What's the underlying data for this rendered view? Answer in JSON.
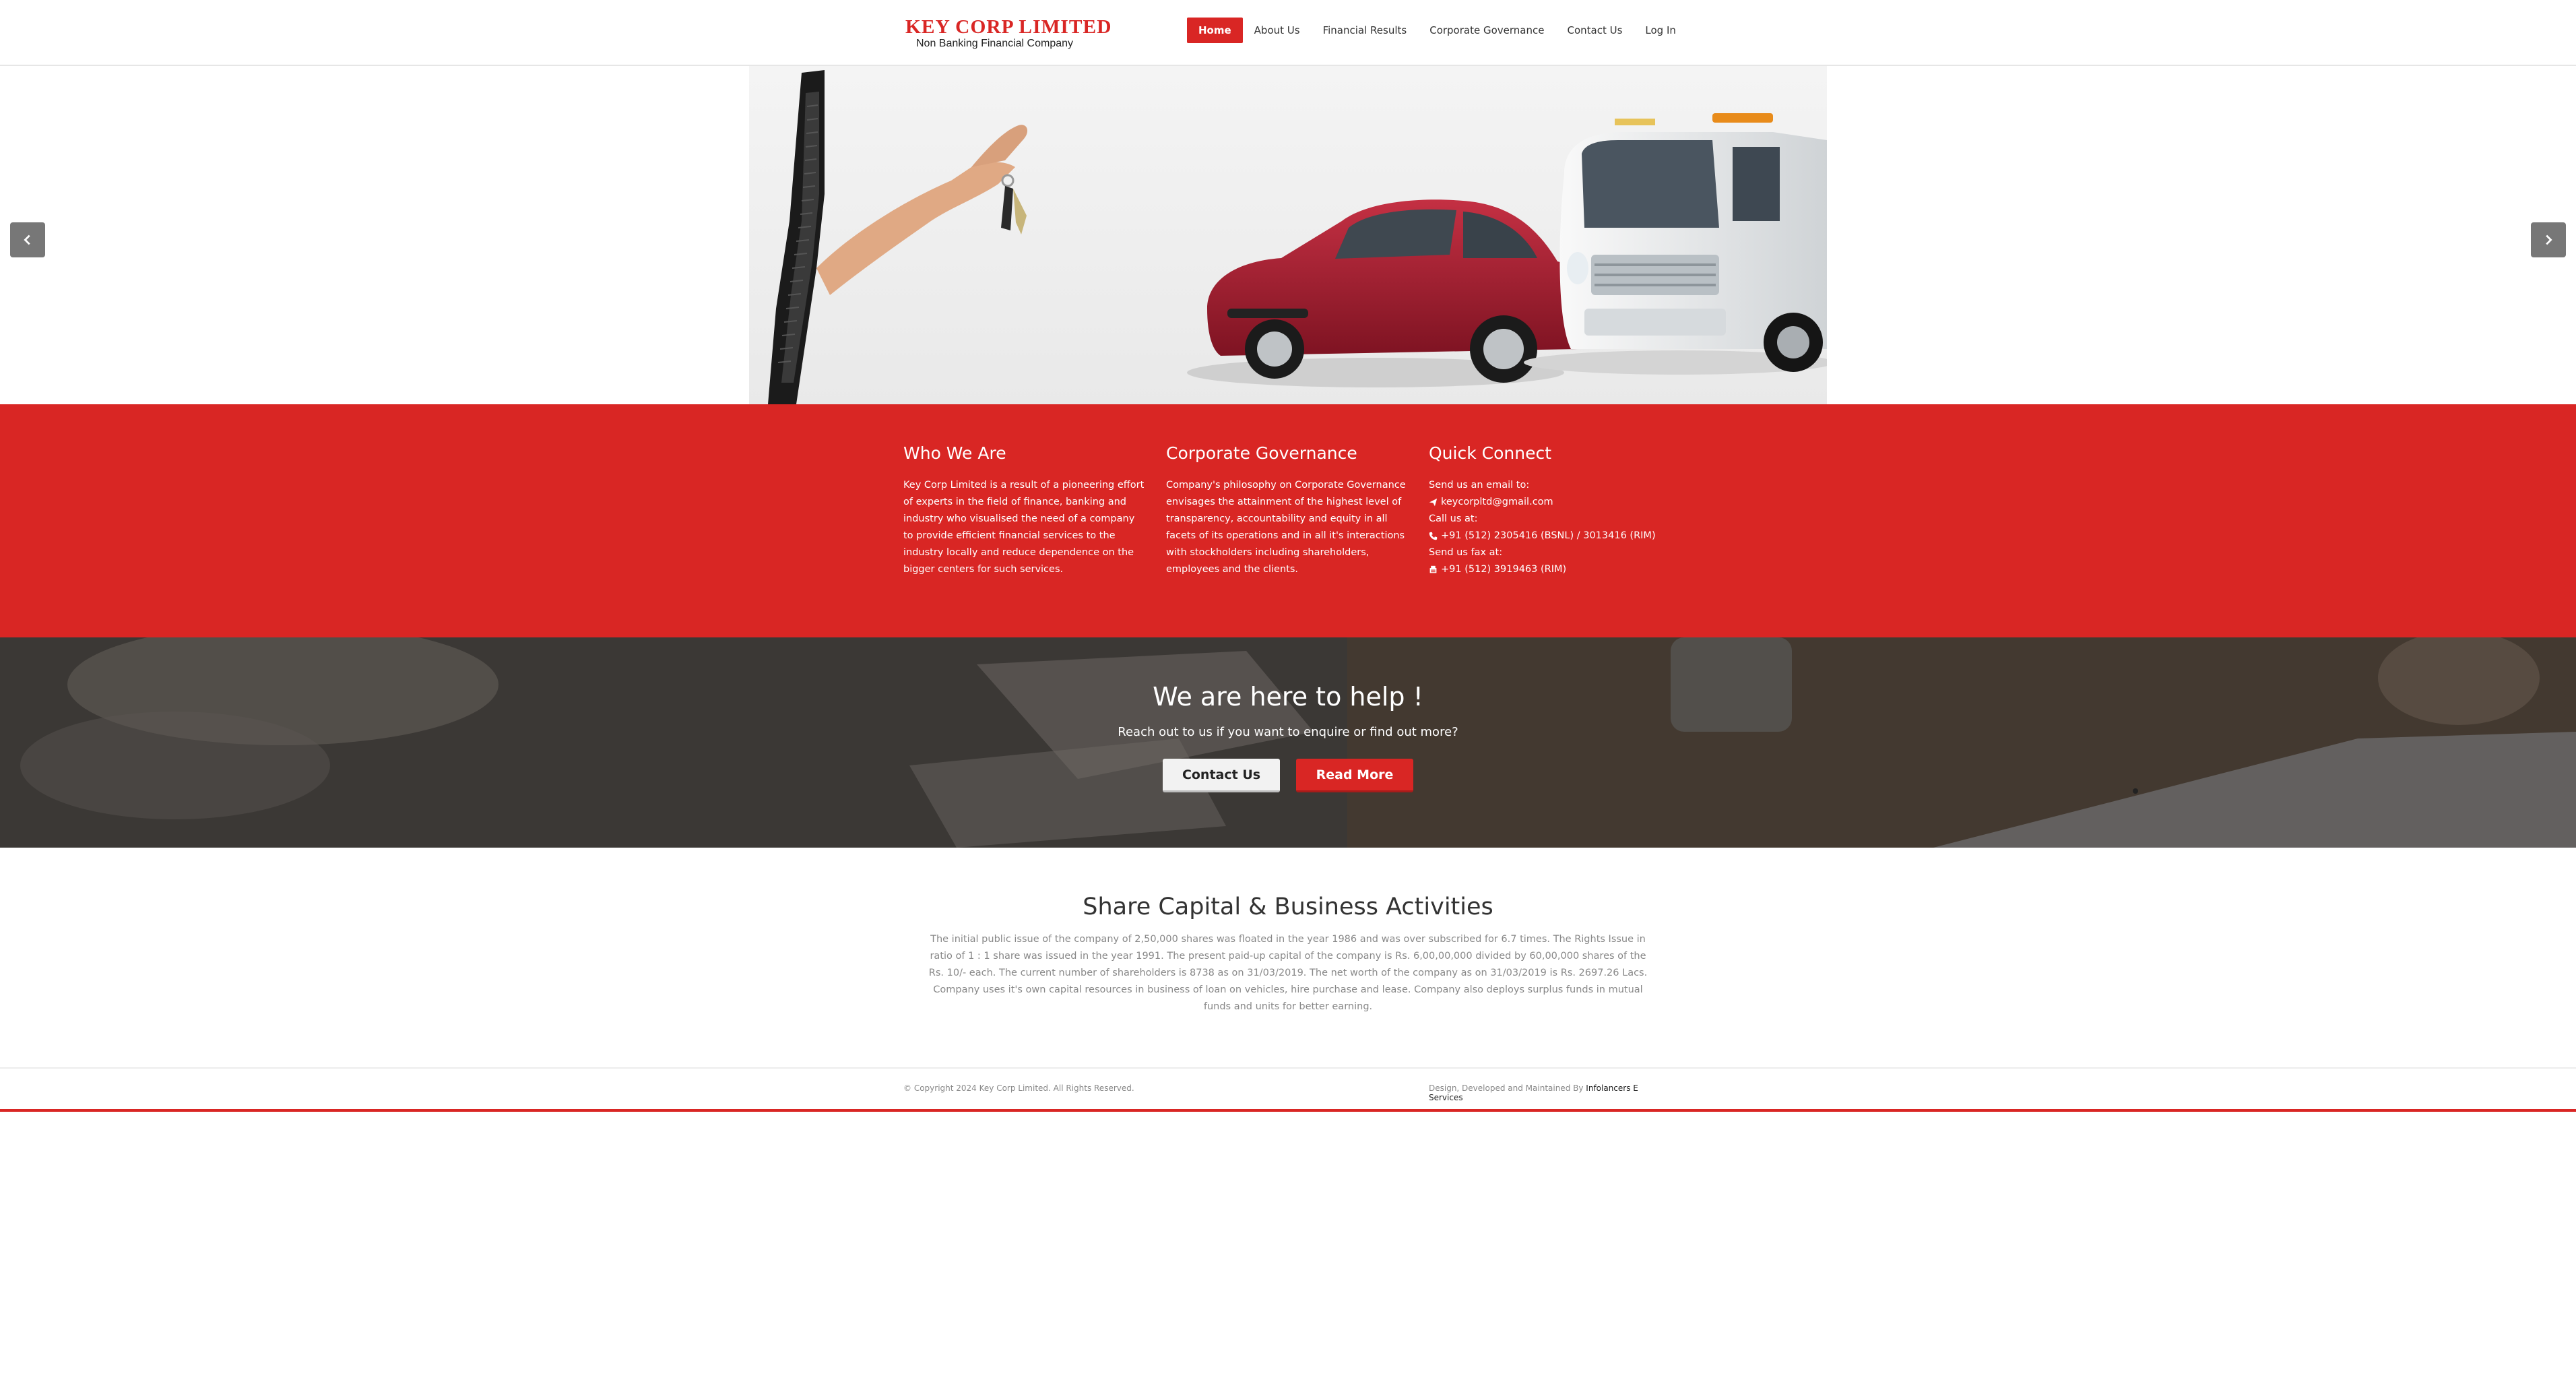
{
  "header": {
    "logo_title": "KEY CORP LIMITED",
    "logo_subtitle": "Non Banking Financial Company",
    "nav": [
      {
        "label": "Home",
        "active": true
      },
      {
        "label": "About Us",
        "active": false
      },
      {
        "label": "Financial Results",
        "active": false
      },
      {
        "label": "Corporate Governance",
        "active": false
      },
      {
        "label": "Contact Us",
        "active": false
      },
      {
        "label": "Log In",
        "active": false
      }
    ]
  },
  "slider": {
    "prev_icon": "chevron-left-icon",
    "next_icon": "chevron-right-icon"
  },
  "info": {
    "who": {
      "title": "Who We Are",
      "text": "Key Corp Limited is a result of a pioneering effort of experts in the field of finance, banking and industry who visualised the need of a company to provide efficient financial services to the industry locally and reduce dependence on the bigger centers for such services."
    },
    "governance": {
      "title": "Corporate Governance",
      "text": "Company's philosophy on Corporate Governance envisages the attainment of the highest level of transparency, accountability and equity in all facets of its operations and in all it's interactions with stockholders including shareholders, employees and the clients."
    },
    "connect": {
      "title": "Quick Connect",
      "email_label": "Send us an email to:",
      "email": "keycorpltd@gmail.com",
      "call_label": "Call us at:",
      "phone": "+91 (512) 2305416 (BSNL) / 3013416 (RIM)",
      "fax_label": "Send us fax at:",
      "fax": "+91 (512) 3919463 (RIM)"
    }
  },
  "help": {
    "title": "We are here to help !",
    "subtitle": "Reach out to us if you want to enquire or find out more?",
    "contact_button": "Contact Us",
    "readmore_button": "Read More"
  },
  "share": {
    "title": "Share Capital & Business Activities",
    "text": "The initial public issue of the company of 2,50,000 shares was floated in the year 1986 and was over subscribed for 6.7 times. The Rights Issue in ratio of 1 : 1 share was issued in the year 1991. The present paid-up capital of the company is Rs. 6,00,00,000 divided by 60,00,000 shares of the Rs. 10/- each. The current number of shareholders is 8738 as on 31/03/2019. The net worth of the company as on 31/03/2019 is Rs. 2697.26 Lacs. Company uses it's own capital resources in business of loan on vehicles, hire purchase and lease. Company also deploys surplus funds in mutual funds and units for better earning."
  },
  "footer": {
    "copyright": "© Copyright 2024 Key Corp Limited. All Rights Reserved.",
    "credit_prefix": "Design, Developed and Maintained By",
    "credit_link": "Infolancers E Services"
  },
  "colors": {
    "brand_red": "#d92624",
    "arrow_gray": "#777777"
  }
}
